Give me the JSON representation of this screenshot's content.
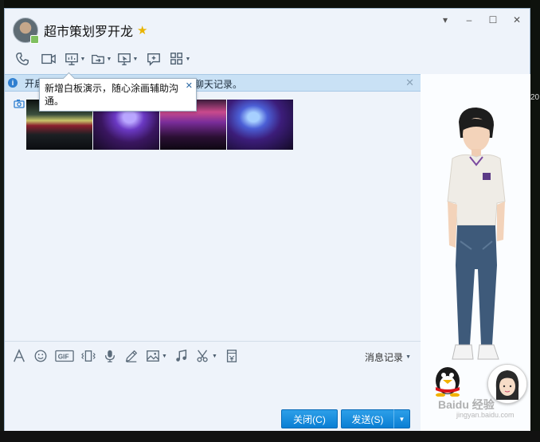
{
  "window": {
    "controls": [
      "▾",
      "–",
      "☐",
      "✕"
    ]
  },
  "header": {
    "contact_name": "超市策划罗开龙"
  },
  "toolbar": {
    "icons": [
      "phone-icon",
      "video-call-icon",
      "whiteboard-icon",
      "file-transfer-icon",
      "screen-share-icon",
      "add-app-icon",
      "apps-grid-icon"
    ]
  },
  "notice": {
    "text_left": "开启",
    "text_right": "聊天记录。",
    "close": "✕"
  },
  "tooltip": {
    "text": "新增白板演示，随心涂画辅助沟通。",
    "close": "✕"
  },
  "message": {
    "photos": [
      "photo-1",
      "photo-2",
      "photo-3",
      "photo-4"
    ]
  },
  "input_toolbar": {
    "gif_label": "GIF",
    "history_label": "消息记录"
  },
  "buttons": {
    "close": "关闭(C)",
    "send": "发送(S)"
  },
  "side": {
    "watermark": "Baidu 经验",
    "watermark_sub": "jingyan.baidu.com"
  },
  "background": {
    "clock_text": "20"
  }
}
